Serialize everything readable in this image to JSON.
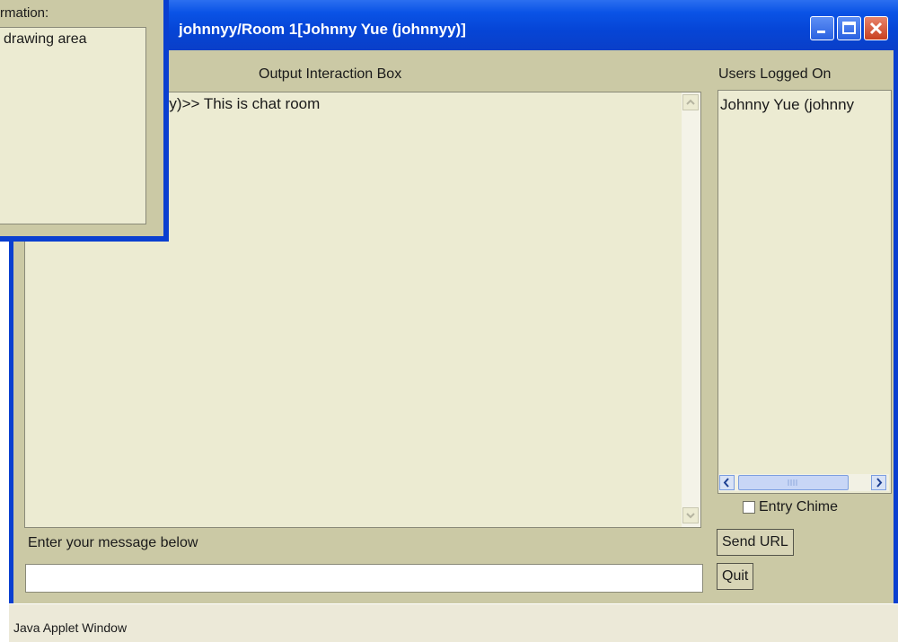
{
  "window": {
    "title": "johnnyy/Room 1[Johnny Yue (johnnyy)]",
    "controls": [
      "minimize-icon",
      "maximize-icon",
      "close-icon"
    ]
  },
  "output": {
    "heading": "Output Interaction Box",
    "messages": [
      {
        "text": "nnyy)>> This is chat room"
      }
    ]
  },
  "users": {
    "heading": "Users Logged On",
    "list": [
      "Johnny Yue (johnny"
    ]
  },
  "entry_chime": {
    "label": "Entry Chime",
    "checked": false
  },
  "message": {
    "label": "Enter your message below",
    "value": ""
  },
  "buttons": {
    "send_url": "Send URL",
    "quit": "Quit"
  },
  "status_bar": {
    "text": "Java Applet Window"
  },
  "info_window": {
    "header": "rmation:",
    "items": [
      "drawing area"
    ]
  },
  "colors": {
    "title_bar": "#0a53e6",
    "panel": "#cbc9a5",
    "field": "#ecebd2",
    "close_button": "#d0502f"
  }
}
